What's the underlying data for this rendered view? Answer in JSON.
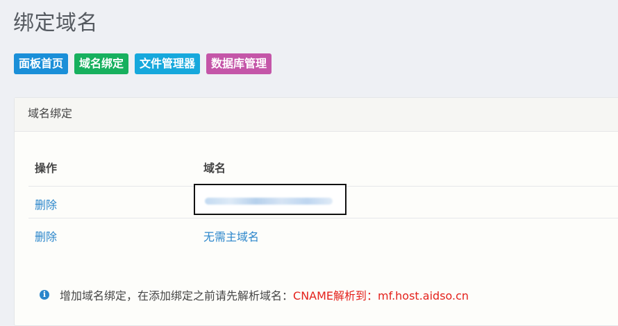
{
  "page": {
    "title": "绑定域名"
  },
  "nav": [
    {
      "label": "面板首页",
      "color": "#1a8fd8"
    },
    {
      "label": "域名绑定",
      "color": "#17b05e"
    },
    {
      "label": "文件管理器",
      "color": "#16a8dc"
    },
    {
      "label": "数据库管理",
      "color": "#c456a8"
    }
  ],
  "panel": {
    "heading": "域名绑定",
    "columns": {
      "action": "操作",
      "domain": "域名"
    },
    "rows": [
      {
        "action": "删除",
        "domain": ""
      },
      {
        "action": "删除",
        "domain": "无需主域名"
      }
    ]
  },
  "notice": {
    "icon": "info-icon",
    "text": "增加域名绑定，在添加绑定之前请先解析域名：",
    "highlight": "CNAME解析到：mf.host.aidso.cn"
  }
}
